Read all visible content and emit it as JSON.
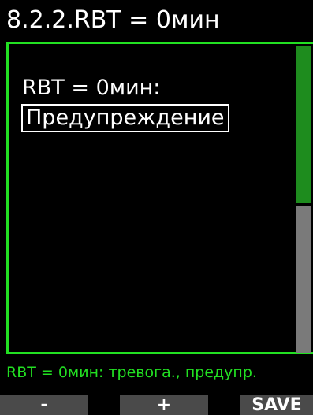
{
  "header": {
    "title": "8.2.2.RBT = 0мин"
  },
  "setting": {
    "label": "RBT = 0мин:",
    "value": "Предупреждение"
  },
  "status": {
    "text": "RBT = 0мин: тревога., предупр."
  },
  "softkeys": {
    "minus": "-",
    "plus": "+",
    "save": "SAVE"
  },
  "colors": {
    "accent": "#22e022",
    "scroll_thumb": "#1e8c1e",
    "scroll_track": "#7a7a7a",
    "softkey_bg": "#4a4a4a",
    "background": "#000000",
    "text": "#ffffff"
  }
}
